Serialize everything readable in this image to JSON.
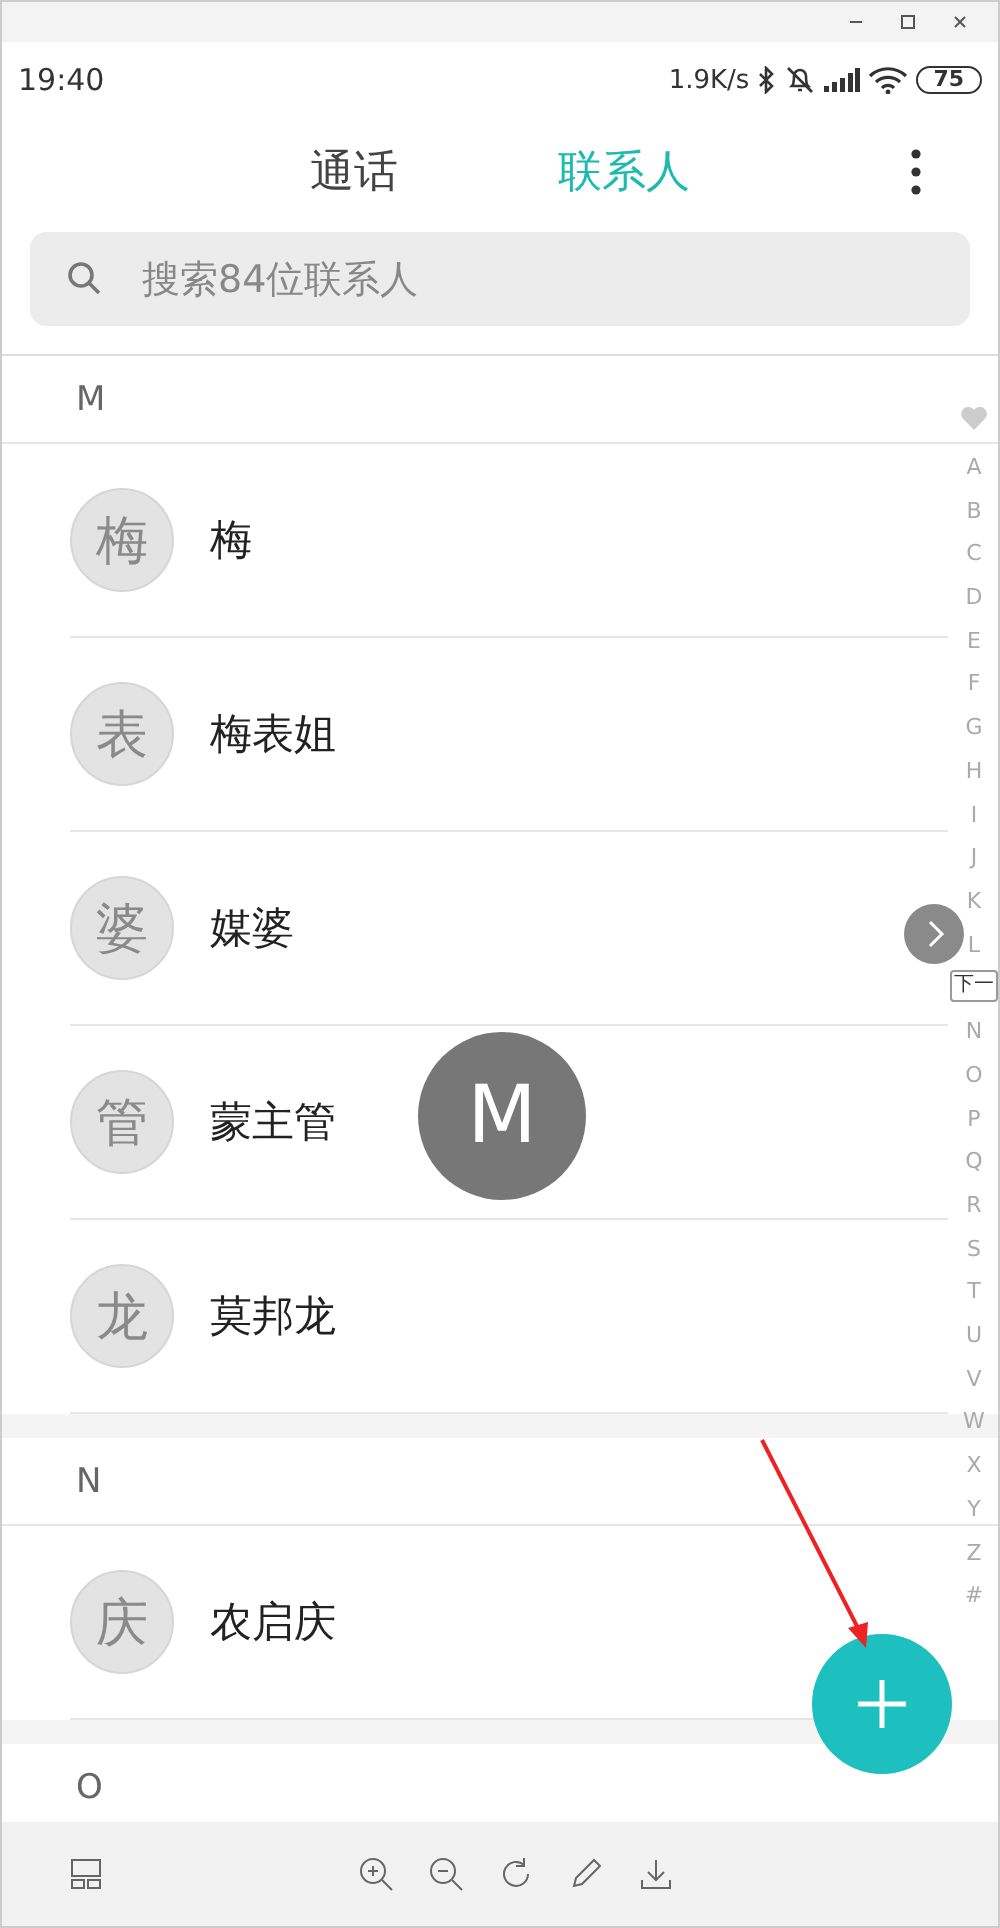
{
  "status_bar": {
    "time": "19:40",
    "speed": "1.9K/s",
    "battery": "75"
  },
  "tabs": [
    {
      "label": "通话",
      "selected": false
    },
    {
      "label": "联系人",
      "selected": true
    }
  ],
  "search": {
    "placeholder": "搜索84位联系人"
  },
  "sections": [
    {
      "letter": "M",
      "contacts": [
        {
          "avatar": "梅",
          "name": "梅"
        },
        {
          "avatar": "表",
          "name": "梅表姐"
        },
        {
          "avatar": "婆",
          "name": "媒婆"
        },
        {
          "avatar": "管",
          "name": "蒙主管"
        },
        {
          "avatar": "龙",
          "name": "莫邦龙"
        }
      ]
    },
    {
      "letter": "N",
      "contacts": [
        {
          "avatar": "庆",
          "name": "农启庆"
        }
      ]
    },
    {
      "letter": "O"
    }
  ],
  "index": [
    {
      "kind": "heart"
    },
    {
      "kind": "letter",
      "text": "A"
    },
    {
      "kind": "letter",
      "text": "B"
    },
    {
      "kind": "letter",
      "text": "C"
    },
    {
      "kind": "letter",
      "text": "D"
    },
    {
      "kind": "letter",
      "text": "E"
    },
    {
      "kind": "letter",
      "text": "F"
    },
    {
      "kind": "letter",
      "text": "G"
    },
    {
      "kind": "letter",
      "text": "H"
    },
    {
      "kind": "letter",
      "text": "I"
    },
    {
      "kind": "letter",
      "text": "J"
    },
    {
      "kind": "letter",
      "text": "K"
    },
    {
      "kind": "letter",
      "text": "L"
    },
    {
      "kind": "tooltip",
      "text": "下一"
    },
    {
      "kind": "letter",
      "text": "N"
    },
    {
      "kind": "letter",
      "text": "O"
    },
    {
      "kind": "letter",
      "text": "P"
    },
    {
      "kind": "letter",
      "text": "Q"
    },
    {
      "kind": "letter",
      "text": "R"
    },
    {
      "kind": "letter",
      "text": "S"
    },
    {
      "kind": "letter",
      "text": "T"
    },
    {
      "kind": "letter",
      "text": "U"
    },
    {
      "kind": "letter",
      "text": "V"
    },
    {
      "kind": "letter",
      "text": "W"
    },
    {
      "kind": "letter",
      "text": "X"
    },
    {
      "kind": "letter",
      "text": "Y"
    },
    {
      "kind": "letter",
      "text": "Z"
    },
    {
      "kind": "letter",
      "text": "#"
    }
  ],
  "letter_bubble": "M"
}
